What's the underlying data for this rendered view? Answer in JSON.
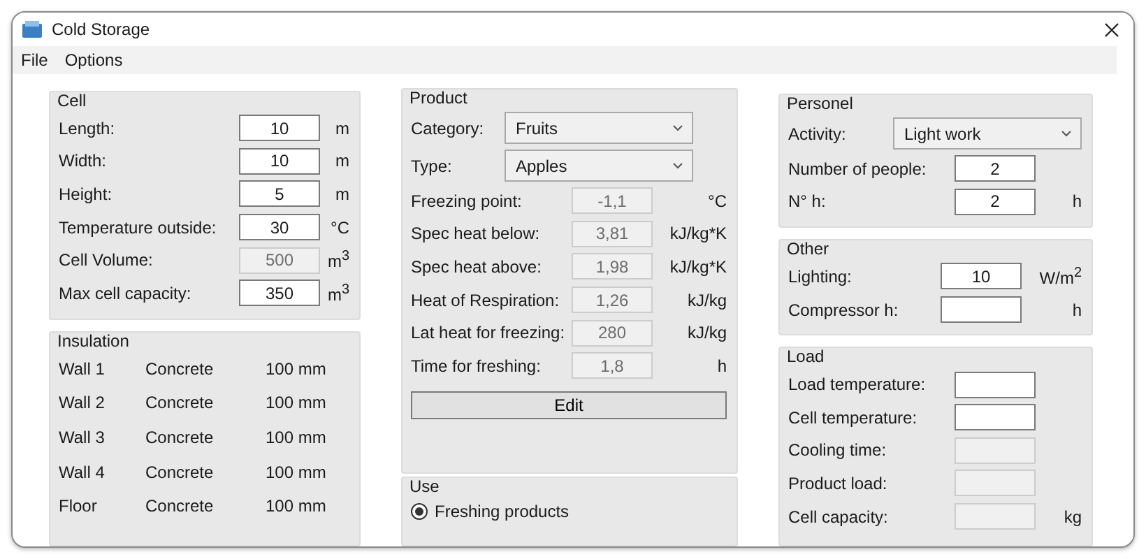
{
  "window": {
    "title": "Cold Storage"
  },
  "menu": [
    {
      "label": "File"
    },
    {
      "label": "Options"
    }
  ],
  "cell": {
    "title": "Cell",
    "rows": [
      {
        "label": "Length:",
        "value": "10",
        "unit": "m",
        "disabled": false
      },
      {
        "label": "Width:",
        "value": "10",
        "unit": "m",
        "disabled": false
      },
      {
        "label": "Height:",
        "value": "5",
        "unit": "m",
        "disabled": false
      },
      {
        "label": "Temperature outside:",
        "value": "30",
        "unit": "°C",
        "disabled": false
      },
      {
        "label": "Cell Volume:",
        "value": "500",
        "unit": "m$^{3}$",
        "disabled": true
      },
      {
        "label": "Max cell capacity:",
        "value": "350",
        "unit": "m$^{3}$",
        "disabled": false
      }
    ]
  },
  "insulation": {
    "title": "Insulation",
    "rows": [
      {
        "name": "Wall 1",
        "material": "Concrete",
        "thickness": "100 mm"
      },
      {
        "name": "Wall 2",
        "material": "Concrete",
        "thickness": "100 mm"
      },
      {
        "name": "Wall 3",
        "material": "Concrete",
        "thickness": "100 mm"
      },
      {
        "name": "Wall 4",
        "material": "Concrete",
        "thickness": "100 mm"
      },
      {
        "name": "Floor",
        "material": "Concrete",
        "thickness": "100 mm"
      }
    ]
  },
  "product": {
    "title": "Product",
    "selects": [
      {
        "label": "Category:",
        "value": "Fruits"
      },
      {
        "label": "Type:",
        "value": "Apples"
      }
    ],
    "rows": [
      {
        "label": "Freezing point:",
        "value": "-1,1",
        "unit": "°C",
        "disabled": true
      },
      {
        "label": "Spec heat below:",
        "value": "3,81",
        "unit": "kJ/kg*K",
        "disabled": true
      },
      {
        "label": "Spec heat above:",
        "value": "1,98",
        "unit": "kJ/kg*K",
        "disabled": true
      },
      {
        "label": "Heat of Respiration:",
        "value": "1,26",
        "unit": "kJ/kg",
        "disabled": true
      },
      {
        "label": "Lat heat for freezing:",
        "value": "280",
        "unit": "kJ/kg",
        "disabled": true
      },
      {
        "label": "Time for freshing:",
        "value": "1,8",
        "unit": "h",
        "disabled": true
      }
    ],
    "edit_button": "Edit",
    "use": {
      "title": "Use",
      "options": [
        {
          "label": "Freshing products",
          "selected": true
        }
      ]
    }
  },
  "personel": {
    "title": "Personel",
    "select": {
      "label": "Activity:",
      "value": "Light work"
    },
    "rows": [
      {
        "label": "Number of people:",
        "value": "2",
        "disabled": false
      },
      {
        "label": "N° h:",
        "value": "2",
        "unit": "h",
        "disabled": false
      }
    ]
  },
  "other": {
    "title": "Other",
    "rows": [
      {
        "label": "Lighting:",
        "value": "10",
        "unit": "W/m$^{2}$",
        "disabled": false
      },
      {
        "label": "Compressor h:",
        "unit": "h",
        "disabled": false
      }
    ]
  },
  "load": {
    "title": "Load",
    "rows": [
      {
        "label": "Load temperature:",
        "disabled": false
      },
      {
        "label": "Cell temperature:",
        "disabled": false
      },
      {
        "label": "Cooling time:",
        "disabled": true
      },
      {
        "label": "Product load:",
        "disabled": true
      },
      {
        "label": "Cell capacity:",
        "unit": "kg",
        "disabled": true
      }
    ]
  }
}
